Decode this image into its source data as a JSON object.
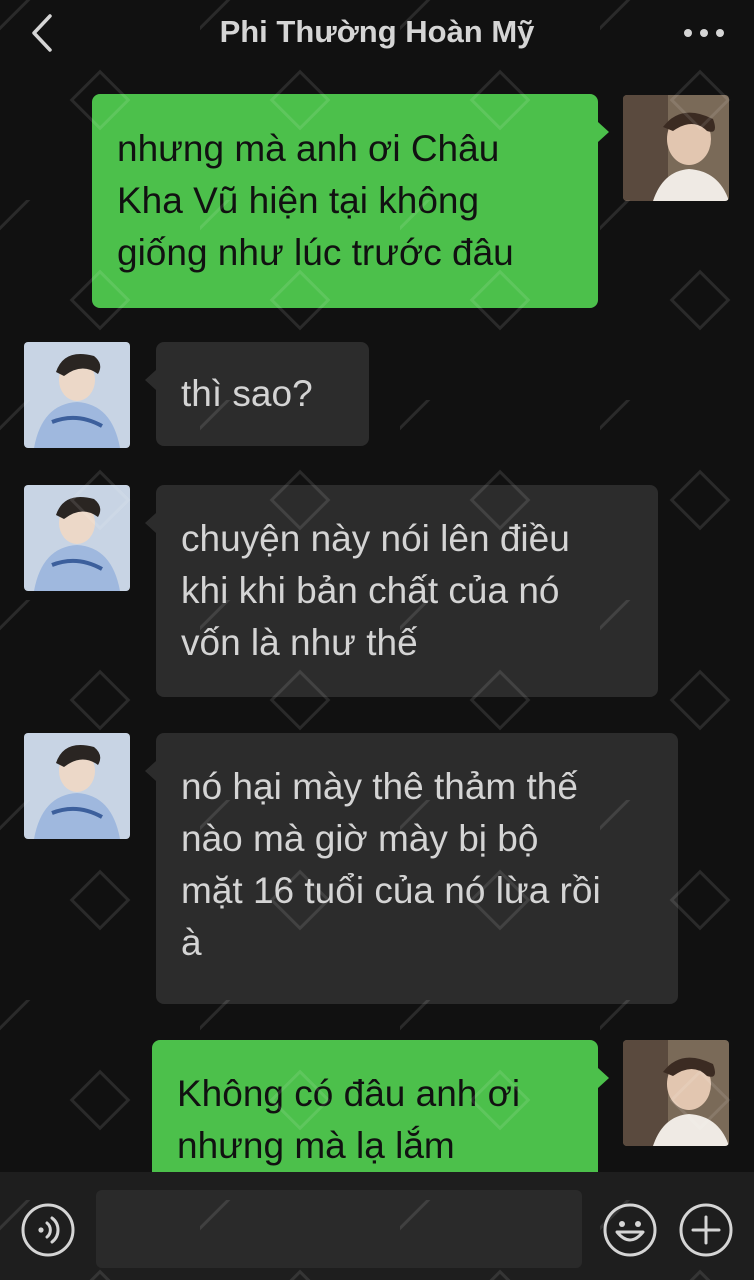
{
  "header": {
    "title": "Phi Thường Hoàn Mỹ",
    "back_icon": "chevron-left-icon",
    "more_icon": "more-dots-icon"
  },
  "messages": [
    {
      "direction": "out",
      "text": "nhưng mà anh ơi Châu Kha Vũ hiện tại không giống như lúc trước đâu",
      "lines": [
        "nhưng mà anh ơi Châu",
        "Kha Vũ hiện tại không",
        "giống như lúc trước đâu"
      ]
    },
    {
      "direction": "in",
      "text": "thì sao?",
      "lines": [
        "thì sao?"
      ]
    },
    {
      "direction": "in",
      "text": "chuyện này nói lên điều khi khi bản chất của nó vốn là như thế",
      "lines": [
        "chuyện này nói lên điều",
        "khi khi bản chất của nó",
        "vốn là như thế"
      ]
    },
    {
      "direction": "in",
      "text": "nó hại mày thê thảm thế nào mà giờ mày bị bộ mặt 16 tuổi của nó lừa rồi à",
      "lines": [
        "nó hại mày thê thảm thế",
        "nào mà giờ mày bị bộ",
        "mặt 16 tuổi của nó lừa rồi",
        "à"
      ]
    },
    {
      "direction": "out",
      "text": "Không có đâu anh ơi nhưng mà lạ lắm",
      "lines": [
        "Không có đâu anh ơi",
        "nhưng mà lạ lắm"
      ]
    }
  ],
  "input_bar": {
    "voice_icon": "voice-icon",
    "input_value": "",
    "emoji_icon": "emoji-icon",
    "plus_icon": "plus-icon"
  },
  "colors": {
    "background": "#111111",
    "outgoing_bubble": "#4cc04b",
    "incoming_bubble": "#2c2c2c",
    "input_bar": "#1e1e1e"
  },
  "watermark_icon": "watermark-pattern"
}
